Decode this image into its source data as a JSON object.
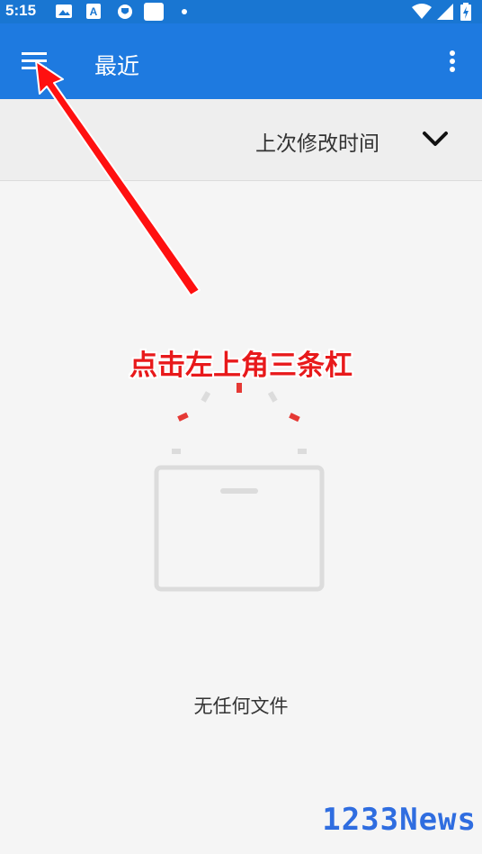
{
  "status_bar": {
    "time": "5:15",
    "icons": [
      "image-icon",
      "a-icon",
      "vpn-icon",
      "square-icon",
      "dot-icon"
    ],
    "right_icons": [
      "wifi-icon",
      "signal-icon",
      "battery-charging-icon"
    ]
  },
  "app_bar": {
    "title": "最近",
    "menu_icon": "menu-icon",
    "overflow_icon": "more-vert-icon",
    "color": "#1e7ae0"
  },
  "sort_bar": {
    "label": "上次修改时间",
    "toggle_icon": "chevron-down-icon"
  },
  "annotation": {
    "text": "点击左上角三条杠",
    "color": "#e8191b"
  },
  "empty_state": {
    "illustration_icon": "empty-folder-icon",
    "text": "无任何文件"
  },
  "watermark": {
    "text": "1233News"
  }
}
